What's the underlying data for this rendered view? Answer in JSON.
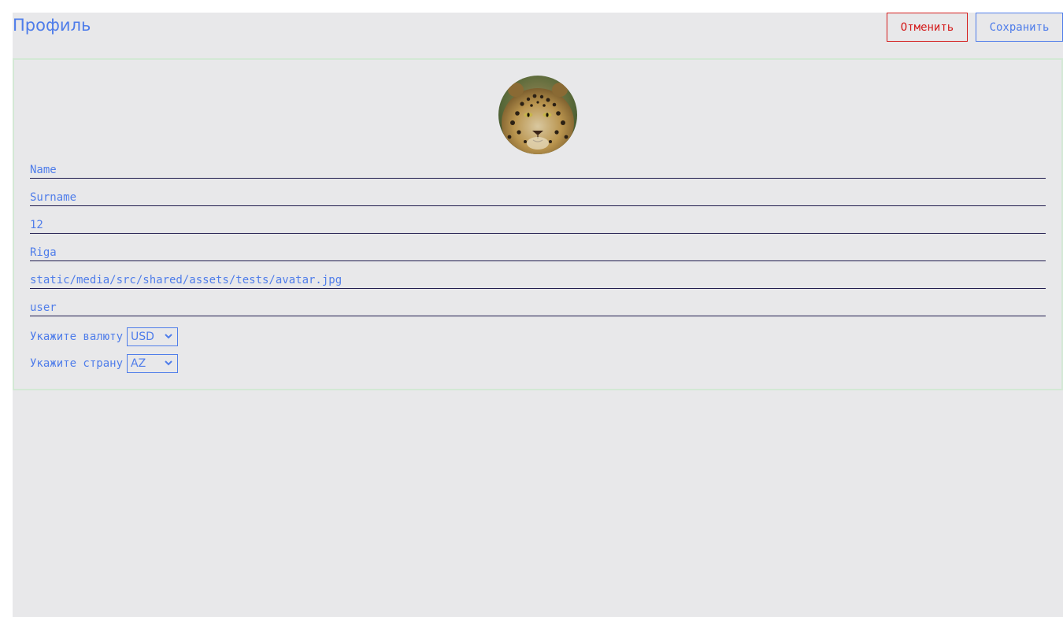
{
  "header": {
    "title": "Профиль",
    "cancel_label": "Отменить",
    "save_label": "Сохранить"
  },
  "profile": {
    "avatar_icon": "leopard-avatar",
    "fields": {
      "first": "Name",
      "lastname": "Surname",
      "age": "12",
      "city": "Riga",
      "avatar": "static/media/src/shared/assets/tests/avatar.jpg",
      "username": "user"
    },
    "currency": {
      "label": "Укажите валюту",
      "value": "USD"
    },
    "country": {
      "label": "Укажите страну",
      "value": "AZ"
    }
  },
  "colors": {
    "accent": "#4f7dea",
    "danger": "#d41c1c",
    "background": "#e8e8ea",
    "card_border": "#d3e8d5",
    "underline": "#1e1a4d"
  }
}
